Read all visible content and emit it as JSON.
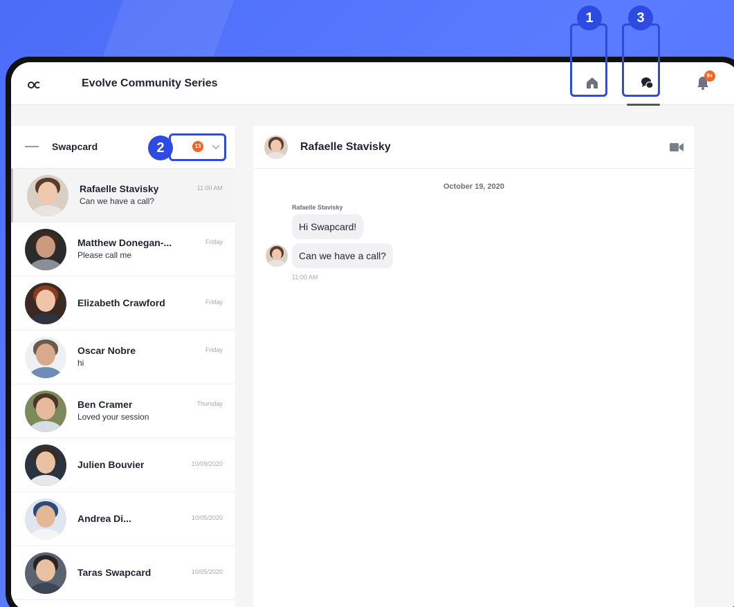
{
  "app": {
    "title": "Evolve Community Series"
  },
  "topbar": {
    "notifications_badge": "9+",
    "icons": [
      "home-icon",
      "chat-icon",
      "bell-icon"
    ]
  },
  "sidebar": {
    "org_name": "Swapcard",
    "unread_count": "13",
    "conversations": [
      {
        "name": "Rafaelle Stavisky",
        "preview": "Can we have a call?",
        "time": "11:00 AM"
      },
      {
        "name": "Matthew Donegan-...",
        "preview": "Please call me",
        "time": "Friday"
      },
      {
        "name": "Elizabeth Crawford",
        "preview": "",
        "time": "Friday"
      },
      {
        "name": "Oscar Nobre",
        "preview": "hi",
        "time": "Friday"
      },
      {
        "name": "Ben Cramer",
        "preview": "Loved your session",
        "time": "Thursday"
      },
      {
        "name": "Julien Bouvier",
        "preview": "",
        "time": "10/09/2020"
      },
      {
        "name": "Andrea Di...",
        "preview": "",
        "time": "10/05/2020"
      },
      {
        "name": "Taras Swapcard",
        "preview": "",
        "time": "10/05/2020"
      }
    ]
  },
  "chat": {
    "contact_name": "Rafaelle Stavisky",
    "date": "October 19, 2020",
    "sender": "Rafaelle Stavisky",
    "messages": [
      {
        "text": "Hi Swapcard!"
      },
      {
        "text": "Can we have a call?"
      }
    ],
    "time": "11:00 AM"
  },
  "callouts": {
    "step1": "1",
    "step2": "2",
    "step3": "3"
  },
  "colors": {
    "accent": "#2d4be0",
    "badge": "#f0652a",
    "background": "#4a6cf7"
  }
}
